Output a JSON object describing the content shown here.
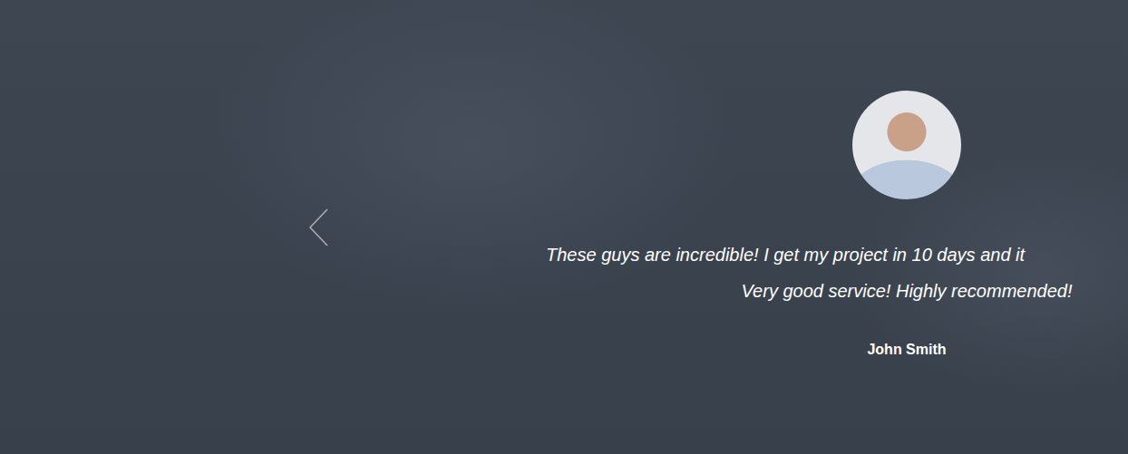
{
  "testimonial": {
    "quote": [
      {
        "text": "These guys are incredible! I get my project in 10 days and it",
        "cut": true
      },
      {
        "text": "Very good service! Highly recommended!",
        "cut": false
      }
    ],
    "author": "John Smith"
  }
}
